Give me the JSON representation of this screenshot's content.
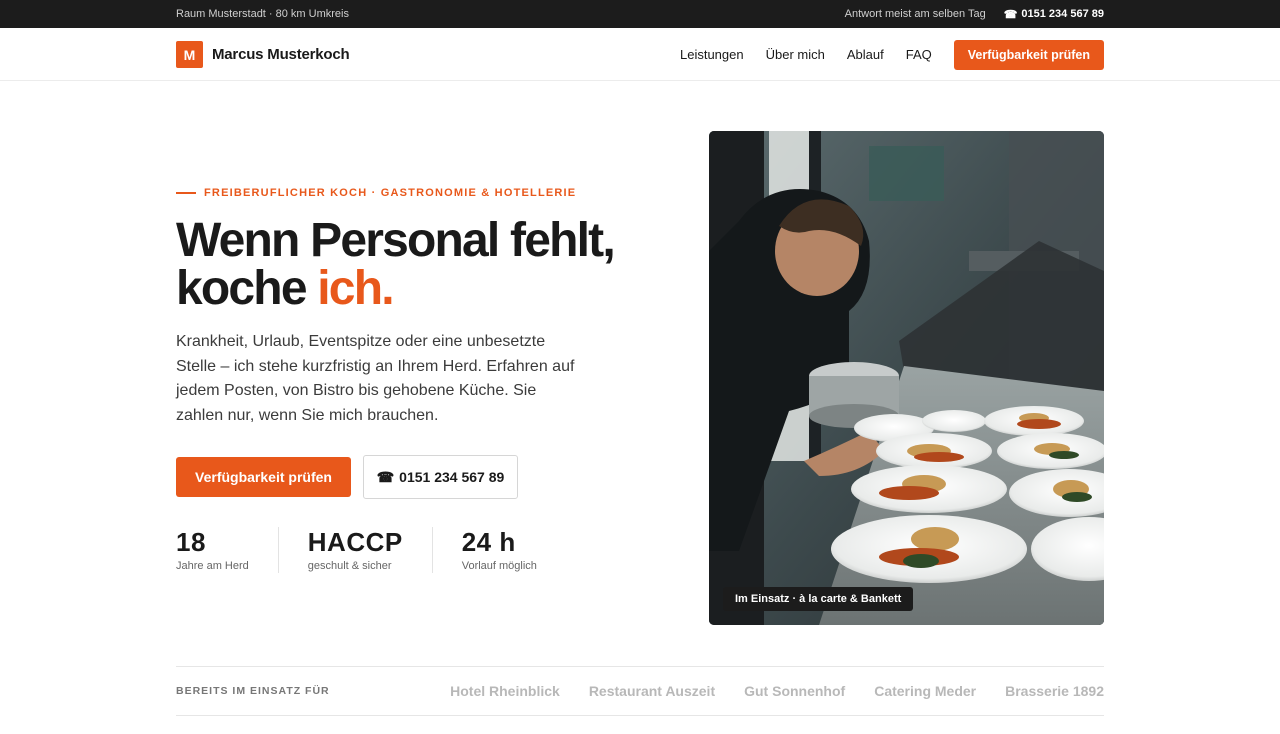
{
  "topbar": {
    "region": "Raum Musterstadt · 80 km Umkreis",
    "response": "Antwort meist am selben Tag",
    "phone_icon": "phone-icon",
    "phone": "0151 234 567 89"
  },
  "nav": {
    "logo_letter": "M",
    "brand": "Marcus Musterkoch",
    "items": [
      "Leistungen",
      "Über mich",
      "Ablauf",
      "FAQ"
    ],
    "cta": "Verfügbarkeit prüfen"
  },
  "hero": {
    "eyebrow": "FREIBERUFLICHER KOCH · GASTRONOMIE & HOTELLERIE",
    "headline_line1": "Wenn Personal fehlt,",
    "headline_line2": "koche ",
    "headline_accent": "ich.",
    "lead": "Krankheit, Urlaub, Eventspitze oder eine unbesetzte Stelle – ich stehe kurzfristig an Ihrem Herd. Erfahren auf jedem Posten, von Bistro bis gehobene Küche. Sie zahlen nur, wenn Sie mich brauchen.",
    "primary_cta": "Verfügbarkeit prüfen",
    "secondary_cta": "0151 234 567 89",
    "stats": [
      {
        "value": "18",
        "label": "Jahre am Herd"
      },
      {
        "value": "HACCP",
        "label": "geschult & sicher"
      },
      {
        "value": "24 h",
        "label": "Vorlauf möglich"
      }
    ],
    "photo_caption": "Im Einsatz · à la carte & Bankett"
  },
  "clients": {
    "label": "BEREITS IM EINSATZ FÜR",
    "names": [
      "Hotel Rheinblick",
      "Restaurant Auszeit",
      "Gut Sonnenhof",
      "Catering Meder",
      "Brasserie 1892"
    ]
  },
  "colors": {
    "accent": "#e8581b",
    "topbar": "#1c1c1c"
  }
}
